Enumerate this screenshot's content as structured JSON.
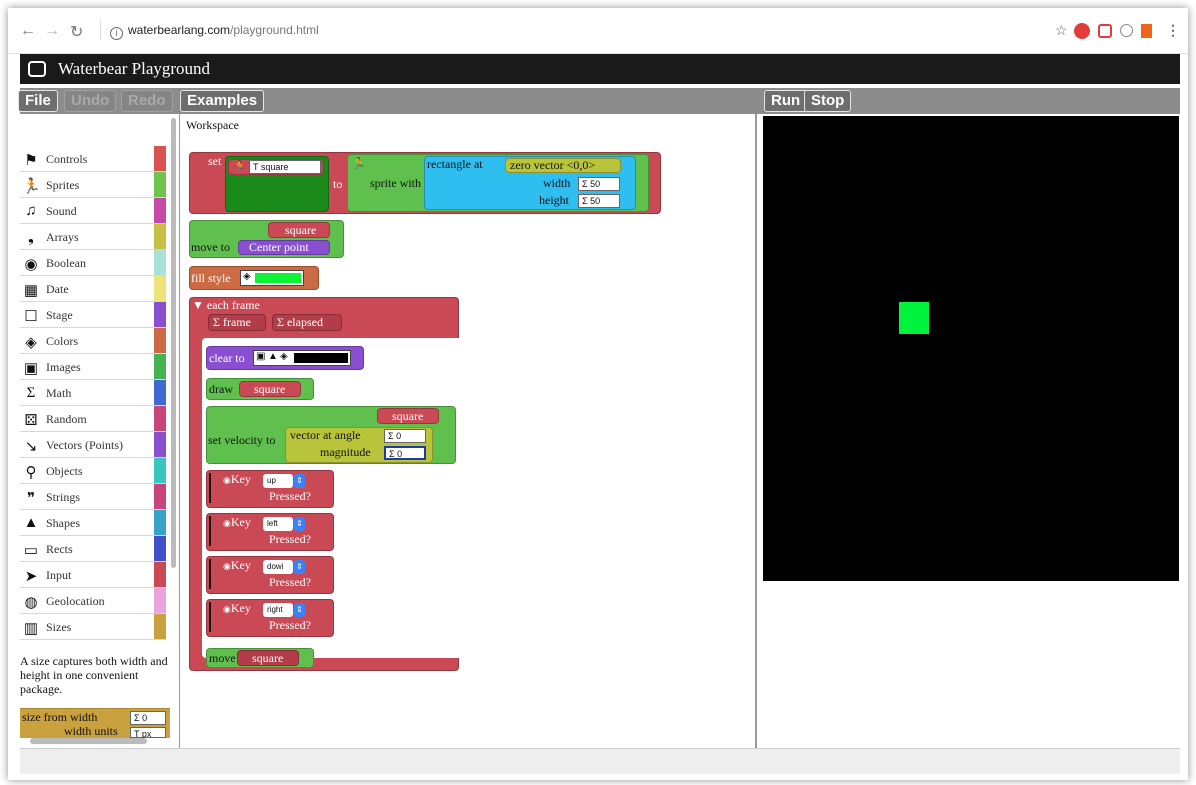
{
  "browser": {
    "url_host": "waterbearlang.com",
    "url_path": "/playground.html",
    "info_glyph": "i"
  },
  "app": {
    "title": "Waterbear Playground"
  },
  "toolbar": {
    "file": "File",
    "undo": "Undo",
    "redo": "Redo",
    "examples": "Examples",
    "run": "Run",
    "stop": "Stop"
  },
  "workspace": {
    "label": "Workspace"
  },
  "palette": {
    "categories": [
      {
        "label": "Controls",
        "icon": "flag-icon",
        "color": "#d9534f"
      },
      {
        "label": "Sprites",
        "icon": "runner-icon",
        "color": "#6cc54a"
      },
      {
        "label": "Sound",
        "icon": "music-note-icon",
        "color": "#c84aa8"
      },
      {
        "label": "Arrays",
        "icon": "comma-icon",
        "color": "#c7c045"
      },
      {
        "label": "Boolean",
        "icon": "toggle-icon",
        "color": "#a9e0d8"
      },
      {
        "label": "Date",
        "icon": "calendar-icon",
        "color": "#ece379"
      },
      {
        "label": "Stage",
        "icon": "square-icon",
        "color": "#8a4fd0"
      },
      {
        "label": "Colors",
        "icon": "paint-bucket-icon",
        "color": "#cc6a44"
      },
      {
        "label": "Images",
        "icon": "image-icon",
        "color": "#44b24f"
      },
      {
        "label": "Math",
        "icon": "sigma-icon",
        "color": "#3f6bd0"
      },
      {
        "label": "Random",
        "icon": "dice-icon",
        "color": "#c8457a"
      },
      {
        "label": "Vectors (Points)",
        "icon": "vector-pin-icon",
        "color": "#8a4fd0"
      },
      {
        "label": "Objects",
        "icon": "link-icon",
        "color": "#39c6c0"
      },
      {
        "label": "Strings",
        "icon": "quote-icon",
        "color": "#c8457a"
      },
      {
        "label": "Shapes",
        "icon": "shapes-icon",
        "color": "#37a3c8"
      },
      {
        "label": "Rects",
        "icon": "rect-icon",
        "color": "#3f4fc8"
      },
      {
        "label": "Input",
        "icon": "cursor-icon",
        "color": "#c94a54"
      },
      {
        "label": "Geolocation",
        "icon": "globe-icon",
        "color": "#e8a4e0"
      },
      {
        "label": "Sizes",
        "icon": "ruler-icon",
        "color": "#c9a13e"
      }
    ],
    "description": "A size captures both width and height in one convenient package.",
    "size_block": {
      "line1": "size from width",
      "width_value": "0",
      "line2": "width units",
      "units_value": "px"
    }
  },
  "blocks": {
    "set_label": "set",
    "var_name": "square",
    "to_label": "to",
    "sprite_with": "sprite with",
    "rect_at": "rectangle at",
    "zero_vector": "zero vector <0,0>",
    "width_label": "width",
    "width_val": "50",
    "height_label": "height",
    "height_val": "50",
    "move_to": "move to",
    "square_ref": "square",
    "center_point": "Center point",
    "fill_style": "fill style",
    "fill_color": "#0df234",
    "each_frame": "each frame",
    "frame_label": "frame",
    "elapsed_label": "elapsed",
    "clear_to": "clear to",
    "draw": "draw",
    "set_velocity": "set velocity to",
    "vector_at_angle": "vector at angle",
    "angle_val": "0",
    "magnitude_label": "magnitude",
    "magnitude_val": "0",
    "key_label": "Key",
    "pressed": "Pressed?",
    "keys": [
      "up",
      "left",
      "dowi",
      "right"
    ],
    "move": "move"
  },
  "stage": {
    "background": "#000000",
    "sprite_color": "#00f23d"
  },
  "icons": {
    "sigma": "Σ",
    "text_t": "T",
    "runner": "🏃",
    "triangle_down": "▼"
  }
}
